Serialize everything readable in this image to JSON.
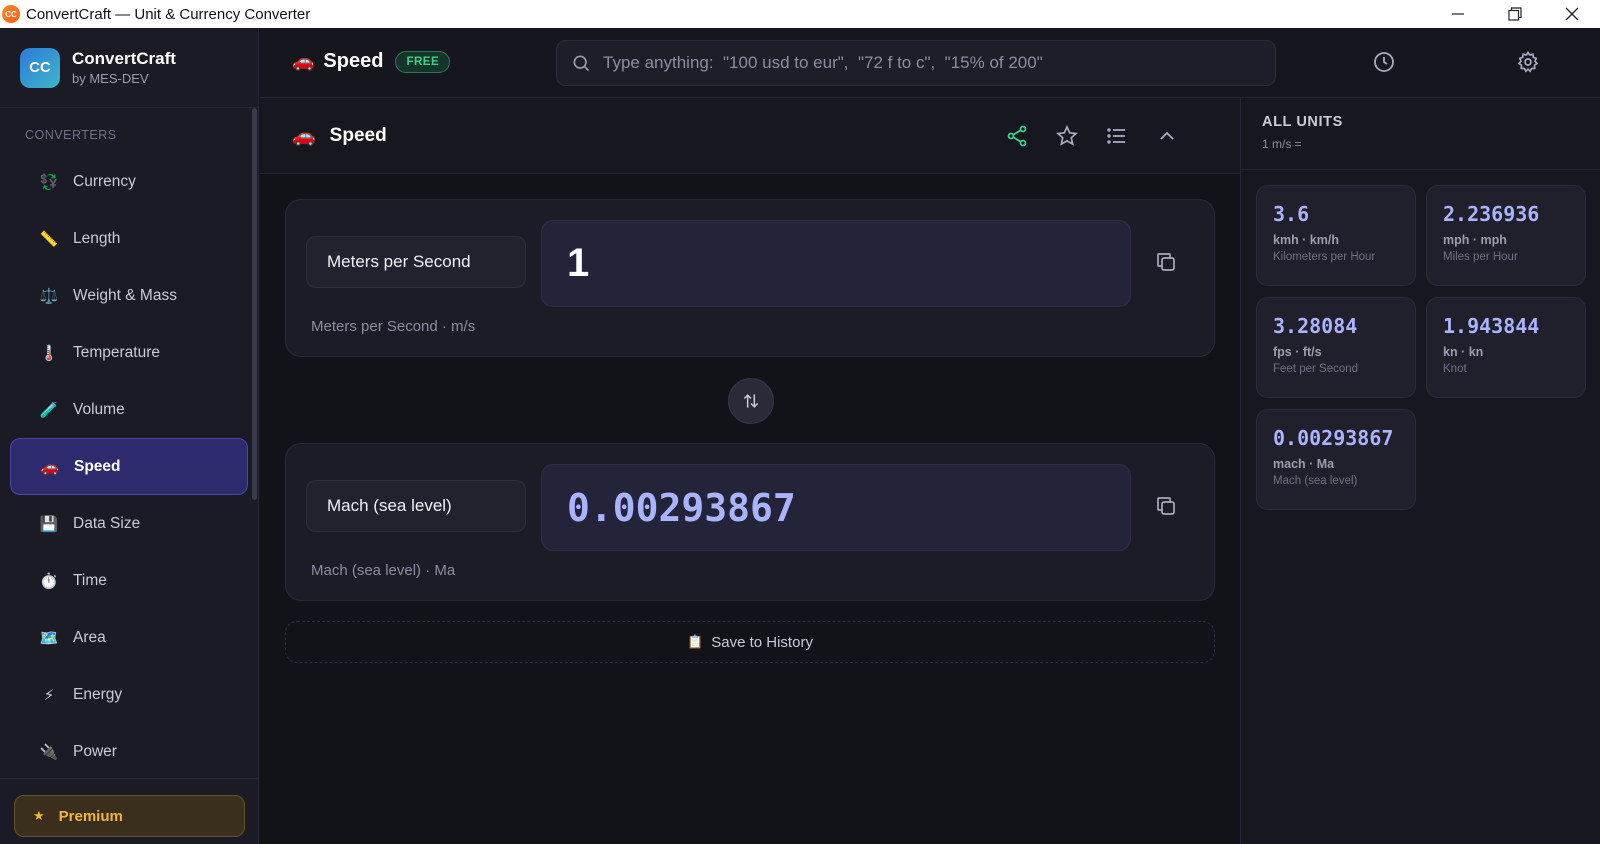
{
  "window": {
    "title": "ConvertCraft — Unit & Currency Converter",
    "icon_text": "CC",
    "controls": [
      "minimize-icon",
      "restore-icon",
      "close-icon"
    ]
  },
  "sidebar": {
    "brand": {
      "logo": "CC",
      "name": "ConvertCraft",
      "sub": "by MES-DEV"
    },
    "section_label": "CONVERTERS",
    "items": [
      {
        "label": "Currency",
        "icon": "💱"
      },
      {
        "label": "Length",
        "icon": "📏"
      },
      {
        "label": "Weight & Mass",
        "icon": "⚖️"
      },
      {
        "label": "Temperature",
        "icon": "🌡️"
      },
      {
        "label": "Volume",
        "icon": "🧪"
      },
      {
        "label": "Speed",
        "icon": "🚗"
      },
      {
        "label": "Data Size",
        "icon": "💾"
      },
      {
        "label": "Time",
        "icon": "⏱️"
      },
      {
        "label": "Area",
        "icon": "🗺️"
      },
      {
        "label": "Energy",
        "icon": "⚡"
      },
      {
        "label": "Power",
        "icon": "🔌"
      }
    ],
    "active_item": "Speed",
    "premium_label": "Premium",
    "premium_icon": "★"
  },
  "header": {
    "title": "Speed",
    "title_icon": "🚗",
    "badge": "FREE",
    "search_placeholder": "Type anything:  \"100 usd to eur\",  \"72 f to c\",  \"15% of 200\"",
    "icons": [
      "history-icon",
      "settings-icon"
    ]
  },
  "converter": {
    "title": "Speed",
    "title_icon": "🚗",
    "actions": [
      "share-icon",
      "star-icon",
      "list-icon",
      "chevron-up-icon"
    ],
    "from": {
      "unit": "Meters per Second",
      "value": "1",
      "sub": "Meters per Second · m/s"
    },
    "to": {
      "unit": "Mach (sea level)",
      "value": "0.00293867",
      "sub": "Mach (sea level) · Ma"
    },
    "save_label": "Save to History",
    "save_icon": "📋"
  },
  "all_units": {
    "title": "ALL UNITS",
    "sub": "1 m/s =",
    "cards": [
      {
        "value": "3.6",
        "code": "kmh · km/h",
        "name": "Kilometers per Hour"
      },
      {
        "value": "2.236936",
        "code": "mph · mph",
        "name": "Miles per Hour"
      },
      {
        "value": "3.28084",
        "code": "fps · ft/s",
        "name": "Feet per Second"
      },
      {
        "value": "1.943844",
        "code": "kn · kn",
        "name": "Knot"
      },
      {
        "value": "0.00293867",
        "code": "mach · Ma",
        "name": "Mach (sea level)"
      }
    ]
  },
  "colors": {
    "accent": "#aab3ff",
    "active_nav": "#2d2a6e",
    "free_badge": "#3ad18a",
    "premium": "#f4b638",
    "share_icon": "#3ad18a"
  }
}
